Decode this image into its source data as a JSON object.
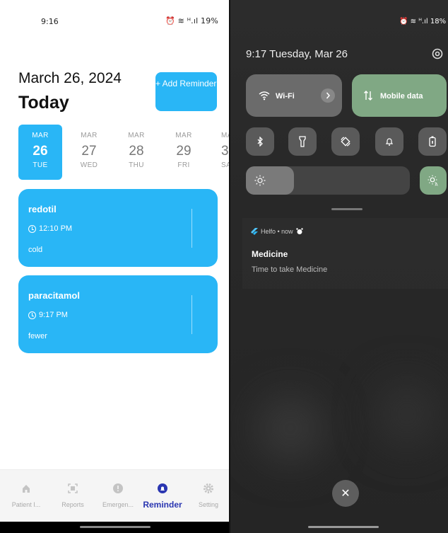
{
  "left": {
    "status": {
      "time": "9:16",
      "icons": "⏰ ≋ ᴴ.ıl 19%"
    },
    "header": {
      "date": "March 26, 2024",
      "today": "Today",
      "add_button": "+ Add Reminder"
    },
    "dates": [
      {
        "month": "MAR",
        "day": "26",
        "weekday": "TUE",
        "selected": true
      },
      {
        "month": "MAR",
        "day": "27",
        "weekday": "WED",
        "selected": false
      },
      {
        "month": "MAR",
        "day": "28",
        "weekday": "THU",
        "selected": false
      },
      {
        "month": "MAR",
        "day": "29",
        "weekday": "FRI",
        "selected": false
      },
      {
        "month": "MA",
        "day": "3",
        "weekday": "SA",
        "selected": false
      }
    ],
    "reminders": [
      {
        "title": "redotil",
        "time": "12:10 PM",
        "note": "cold"
      },
      {
        "title": "paracitamol",
        "time": "9:17 PM",
        "note": "fewer"
      }
    ],
    "nav": [
      {
        "label": "Patient I..."
      },
      {
        "label": "Reports"
      },
      {
        "label": "Emergen..."
      },
      {
        "label": "Reminder"
      },
      {
        "label": "Setting"
      }
    ],
    "accent": "#29b6f6",
    "active_color": "#2a36b1"
  },
  "right": {
    "status": {
      "icons": "⏰ ≋ ᴴ.ıl 18%"
    },
    "header": "9:17  Tuesday, Mar 26",
    "tiles": {
      "wifi": "Wi-Fi",
      "mobile": "Mobile data"
    },
    "notification": {
      "app": "Helfo • now",
      "title": "Medicine",
      "body": "Time to take Medicine"
    },
    "close_symbol": "✕"
  }
}
